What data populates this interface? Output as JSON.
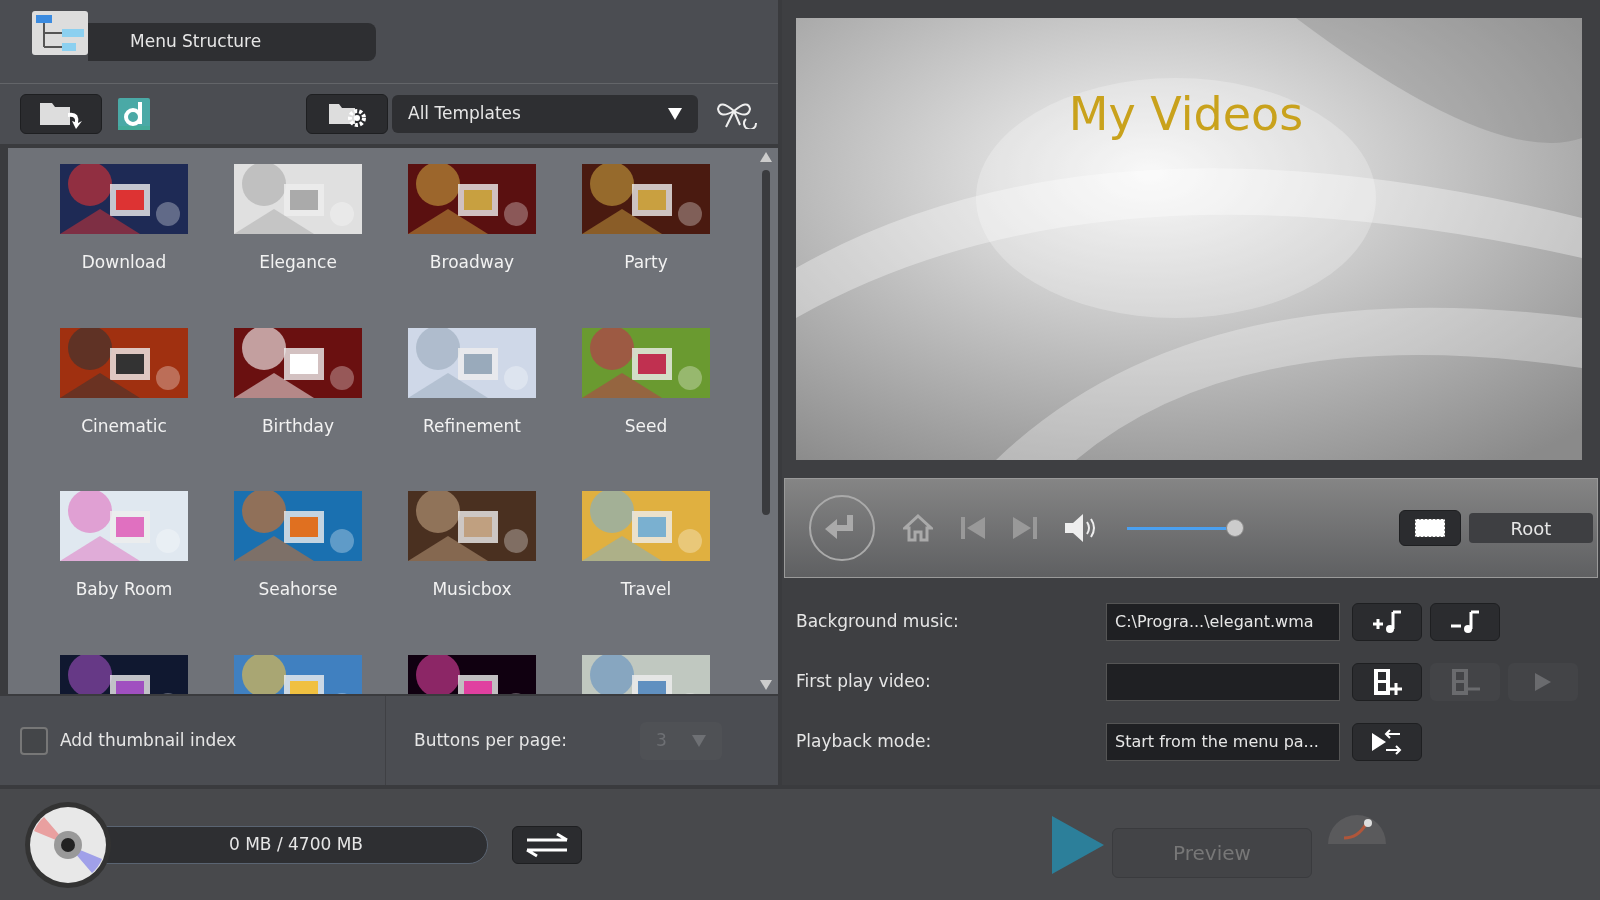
{
  "menu_structure_button": "Menu Structure",
  "template_filter": {
    "value": "All Templates"
  },
  "templates": [
    {
      "kind": "labeled",
      "label": "Download"
    },
    {
      "kind": "labeled",
      "label": "Elegance"
    },
    {
      "kind": "labeled",
      "label": "Broadway"
    },
    {
      "kind": "labeled",
      "label": "Party"
    },
    {
      "kind": "labeled",
      "label": "Cinematic"
    },
    {
      "kind": "labeled",
      "label": "Birthday"
    },
    {
      "kind": "labeled",
      "label": "Refinement"
    },
    {
      "kind": "labeled",
      "label": "Seed"
    },
    {
      "kind": "labeled",
      "label": "Baby Room"
    },
    {
      "kind": "labeled",
      "label": "Seahorse"
    },
    {
      "kind": "labeled",
      "label": "Musicbox"
    },
    {
      "kind": "labeled",
      "label": "Travel"
    },
    {
      "kind": "partial"
    },
    {
      "kind": "partial"
    },
    {
      "kind": "partial"
    },
    {
      "kind": "partial"
    }
  ],
  "thumbnail_index": {
    "label": "Add thumbnail index",
    "checked": false
  },
  "buttons_per_page": {
    "label": "Buttons per page:",
    "value": "3",
    "disabled": true
  },
  "preview": {
    "title": "My Videos"
  },
  "player": {
    "volume": {
      "level": 0.9
    },
    "root_label": "Root"
  },
  "settings": [
    {
      "label": "Background music:",
      "value": "C:\\Progra...\\elegant.wma"
    },
    {
      "label": "First play video:"
    },
    {
      "label": "Playback mode:",
      "value": "Start from the menu pa..."
    }
  ],
  "disc": {
    "usage": "0 MB / 4700 MB"
  },
  "preview_button": "Preview"
}
